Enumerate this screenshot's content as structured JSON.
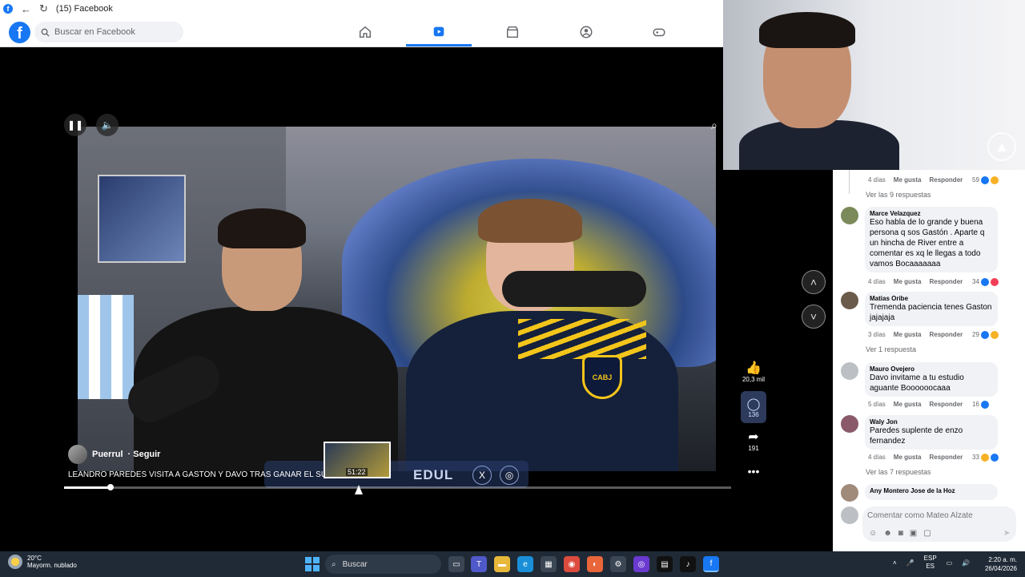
{
  "browser": {
    "tab_title": "(15) Facebook"
  },
  "fb": {
    "search_placeholder": "Buscar en Facebook",
    "nav": [
      "home",
      "video",
      "marketplace",
      "groups",
      "gaming"
    ]
  },
  "video": {
    "channel_name": "Puerrul",
    "follow_label": "· Seguir",
    "title": "LEANDRO PAREDES VISITA A GASTÓN Y DAVO TRAS GANAR EL SUPERC",
    "banner_text": "EDUL",
    "preview_time": "51:22",
    "progress_fraction": 0.07,
    "jersey_badge": "CABJ"
  },
  "reactions": {
    "likes": "20,3 mil",
    "comments": "136",
    "shares": "191"
  },
  "comments_panel": {
    "top_meta": {
      "time": "4 días",
      "like": "Me gusta",
      "reply": "Responder",
      "count": "59"
    },
    "view_9": "Ver las 9 respuestas",
    "items": [
      {
        "name": "Marce Velazquez",
        "text": "Eso habla de lo grande y buena persona q sos Gastón . Aparte q un hincha de River entre a comentar es xq le llegas a todo vamos Bocaaaaaaa",
        "time": "4 días",
        "like": "Me gusta",
        "reply": "Responder",
        "count": "34"
      },
      {
        "name": "Matias Oribe",
        "text": "Tremenda paciencia tenes Gaston jajajaja",
        "time": "3 días",
        "like": "Me gusta",
        "reply": "Responder",
        "count": "29"
      },
      {
        "name": "Mauro Ovejero",
        "text": "Davo invitame a tu estudio aguante Boooooocaaa",
        "time": "5 días",
        "like": "Me gusta",
        "reply": "Responder",
        "count": "16"
      },
      {
        "name": "Waly Jon",
        "text": "Paredes suplente de enzo fernandez",
        "time": "4 días",
        "like": "Me gusta",
        "reply": "Responder",
        "count": "33"
      },
      {
        "name": "Any Montero Jose de la Hoz",
        "text": "",
        "time": "",
        "like": "",
        "reply": "",
        "count": ""
      }
    ],
    "view_1": "Ver 1 respuesta",
    "view_7": "Ver las 7 respuestas",
    "input_placeholder": "Comentar como Mateo Alzate"
  },
  "taskbar": {
    "temperature": "20°C",
    "weather": "Mayorm. nublado",
    "search_label": "Buscar",
    "lang_top": "ESP",
    "lang_bottom": "ES",
    "time": "2:20 a. m.",
    "date": "26/04/2026"
  },
  "colors": {
    "fb_blue": "#1877f2",
    "taskbar": "#1f2a36"
  }
}
